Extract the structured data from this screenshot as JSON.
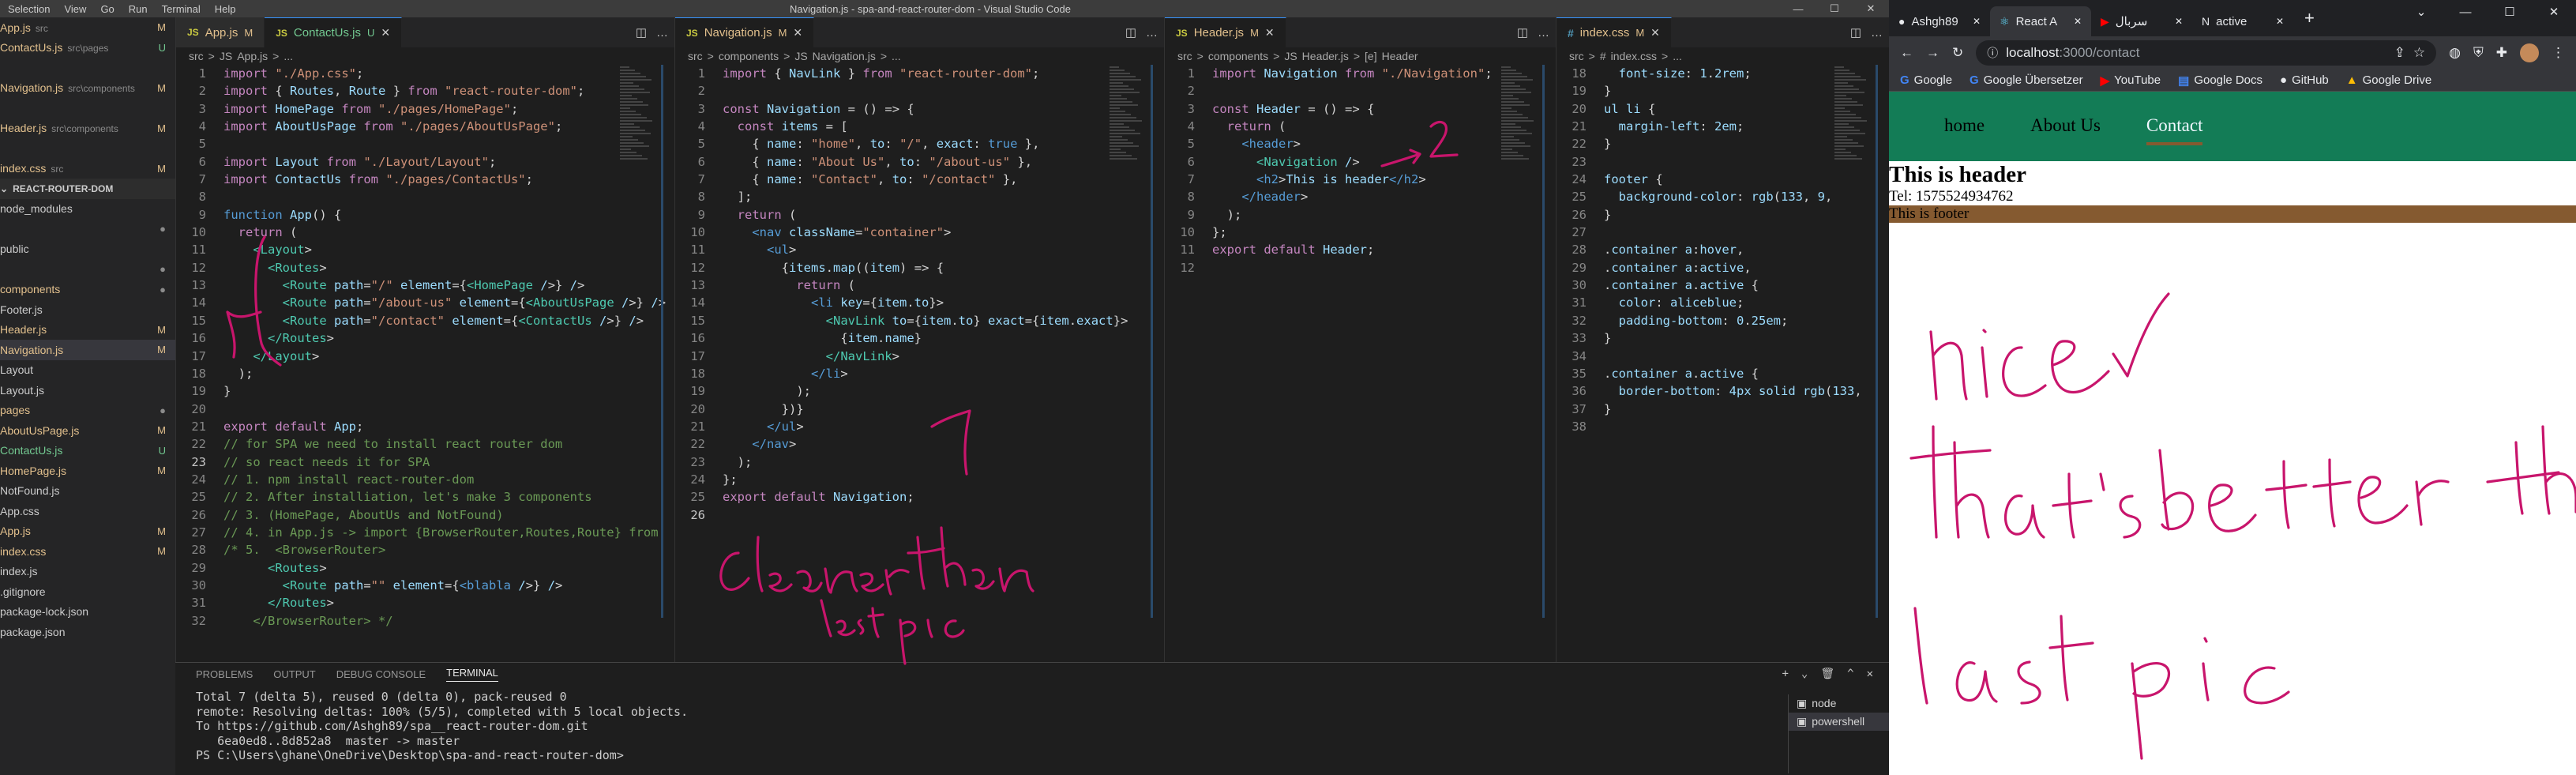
{
  "vscode": {
    "title": "Navigation.js - spa-and-react-router-dom - Visual Studio Code",
    "menu": [
      "Selection",
      "View",
      "Go",
      "Run",
      "Terminal",
      "Help"
    ]
  },
  "sidebar": {
    "open_editors": [
      {
        "name": "App.js",
        "path": "src",
        "status": "M"
      },
      {
        "name": "ContactUs.js",
        "path": "src\\pages",
        "status": "U"
      },
      {
        "name": "",
        "path": "",
        "status": ""
      },
      {
        "name": "Navigation.js",
        "path": "src\\components",
        "status": "M"
      },
      {
        "name": "",
        "path": "",
        "status": ""
      },
      {
        "name": "Header.js",
        "path": "src\\components",
        "status": "M"
      },
      {
        "name": "",
        "path": "",
        "status": ""
      },
      {
        "name": "index.css",
        "path": "src",
        "status": "M"
      }
    ],
    "section_title": "REACT-ROUTER-DOM",
    "tree": [
      {
        "name": "node_modules",
        "status": ""
      },
      {
        "name": "",
        "status": "●"
      },
      {
        "name": "public",
        "status": ""
      },
      {
        "name": "",
        "status": "●"
      },
      {
        "name": "components",
        "status": "●"
      },
      {
        "name": "Footer.js",
        "status": ""
      },
      {
        "name": "Header.js",
        "status": "M"
      },
      {
        "name": "Navigation.js",
        "status": "M"
      },
      {
        "name": "Layout",
        "status": ""
      },
      {
        "name": "Layout.js",
        "status": ""
      },
      {
        "name": "pages",
        "status": "●"
      },
      {
        "name": "AboutUsPage.js",
        "status": "M"
      },
      {
        "name": "ContactUs.js",
        "status": "U"
      },
      {
        "name": "HomePage.js",
        "status": "M"
      },
      {
        "name": "NotFound.js",
        "status": ""
      },
      {
        "name": "App.css",
        "status": ""
      },
      {
        "name": "App.js",
        "status": "M"
      },
      {
        "name": "index.css",
        "status": "M"
      },
      {
        "name": "index.js",
        "status": ""
      },
      {
        "name": ".gitignore",
        "status": ""
      },
      {
        "name": "package-lock.json",
        "status": ""
      },
      {
        "name": "package.json",
        "status": ""
      }
    ]
  },
  "groups": [
    {
      "tabs": [
        {
          "icon": "JS",
          "label": "App.js",
          "mark": "M",
          "active": false
        },
        {
          "icon": "JS",
          "label": "ContactUs.js",
          "mark": "U",
          "active": true
        }
      ],
      "crumbs": [
        "src",
        ">",
        "JS",
        "App.js",
        ">",
        "..."
      ],
      "start": 1,
      "current": 23,
      "lines": [
        "import \"./App.css\";",
        "import { Routes, Route } from \"react-router-dom\";",
        "import HomePage from \"./pages/HomePage\";",
        "import AboutUsPage from \"./pages/AboutUsPage\";",
        "",
        "import Layout from \"./Layout/Layout\";",
        "import ContactUs from \"./pages/ContactUs\";",
        "",
        "function App() {",
        "  return (",
        "    <Layout>",
        "      <Routes>",
        "        <Route path=\"/\" element={<HomePage />} />",
        "        <Route path=\"/about-us\" element={<AboutUsPage />} />",
        "        <Route path=\"/contact\" element={<ContactUs />} />",
        "      </Routes>",
        "    </Layout>",
        "  );",
        "}",
        "",
        "export default App;",
        "// for SPA we need to install react router dom",
        "// so react needs it for SPA",
        "// 1. npm install react-router-dom",
        "// 2. After installiation, let's make 3 components",
        "// 3. (HomePage, AboutUs and NotFound)",
        "// 4. in App.js -> import {BrowserRouter,Routes,Route} from",
        "/* 5.  <BrowserRouter>",
        "      <Routes>",
        "        <Route path=\"\" element={<blabla />} />",
        "      </Routes>",
        "    </BrowserRouter> */"
      ]
    },
    {
      "tabs": [
        {
          "icon": "JS",
          "label": "Navigation.js",
          "mark": "M",
          "active": true
        }
      ],
      "crumbs": [
        "src",
        ">",
        "components",
        ">",
        "JS",
        "Navigation.js",
        ">",
        "..."
      ],
      "start": 1,
      "current": 26,
      "lines": [
        "import { NavLink } from \"react-router-dom\";",
        "",
        "const Navigation = () => {",
        "  const items = [",
        "    { name: \"home\", to: \"/\", exact: true },",
        "    { name: \"About Us\", to: \"/about-us\" },",
        "    { name: \"Contact\", to: \"/contact\" },",
        "  ];",
        "  return (",
        "    <nav className=\"container\">",
        "      <ul>",
        "        {items.map((item) => {",
        "          return (",
        "            <li key={item.to}>",
        "              <NavLink to={item.to} exact={item.exact}>",
        "                {item.name}",
        "              </NavLink>",
        "            </li>",
        "          );",
        "        })}",
        "      </ul>",
        "    </nav>",
        "  );",
        "};",
        "export default Navigation;",
        ""
      ]
    },
    {
      "tabs": [
        {
          "icon": "JS",
          "label": "Header.js",
          "mark": "M",
          "active": true
        }
      ],
      "crumbs": [
        "src",
        ">",
        "components",
        ">",
        "JS",
        "Header.js",
        ">",
        "[e]",
        "Header"
      ],
      "start": 1,
      "current": 0,
      "lines": [
        "import Navigation from \"./Navigation\";",
        "",
        "const Header = () => {",
        "  return (",
        "    <header>",
        "      <Navigation />",
        "      <h2>This is header</h2>",
        "    </header>",
        "  );",
        "};",
        "export default Header;",
        ""
      ]
    },
    {
      "tabs": [
        {
          "icon": "#",
          "label": "index.css",
          "mark": "M",
          "active": true
        }
      ],
      "crumbs": [
        "src",
        ">",
        "#",
        "index.css",
        ">",
        "..."
      ],
      "start": 18,
      "current": 0,
      "lines": [
        "  font-size: 1.2rem;",
        "}",
        "ul li {",
        "  margin-left: 2em;",
        "}",
        "",
        "footer {",
        "  background-color: rgb(133, 9,",
        "}",
        "",
        ".container a:hover,",
        ".container a:active,",
        ".container a.active {",
        "  color: aliceblue;",
        "  padding-bottom: 0.25em;",
        "}",
        "",
        ".container a.active {",
        "  border-bottom: 4px solid rgb(133,",
        "}",
        ""
      ]
    }
  ],
  "panel": {
    "tabs": [
      "PROBLEMS",
      "OUTPUT",
      "DEBUG CONSOLE",
      "TERMINAL"
    ],
    "active": "TERMINAL",
    "terminal_lines": [
      "Total 7 (delta 5), reused 0 (delta 0), pack-reused 0",
      "remote: Resolving deltas: 100% (5/5), completed with 5 local objects.",
      "To https://github.com/Ashgh89/spa__react-router-dom.git",
      "   6ea0ed8..8d852a8  master -> master",
      "PS C:\\Users\\ghane\\OneDrive\\Desktop\\spa-and-react-router-dom> "
    ],
    "terminals": [
      "node",
      "powershell"
    ]
  },
  "browser": {
    "tabs": [
      {
        "label": "Ashgh89",
        "icon": "github-icon"
      },
      {
        "label": "React A",
        "icon": "react-icon"
      },
      {
        "label": "سربال",
        "icon": "youtube-icon"
      },
      {
        "label": "active",
        "icon": "notion-icon"
      }
    ],
    "url_host": "localhost",
    "url_path": ":3000/contact",
    "bookmarks": [
      "Google",
      "Google Übersetzer",
      "YouTube",
      "Google Docs",
      "GitHub",
      "Google Drive"
    ]
  },
  "site": {
    "nav": [
      {
        "label": "home",
        "active": false
      },
      {
        "label": "About Us",
        "active": false
      },
      {
        "label": "Contact",
        "active": true
      }
    ],
    "header": "This is header",
    "tel": "Tel: 1575524934762",
    "footer": "This is footer"
  },
  "ink": {
    "color": "#c8156c",
    "notes": [
      "Cleaner than",
      "last pic",
      "nice",
      "that's better than",
      "last pic"
    ]
  }
}
